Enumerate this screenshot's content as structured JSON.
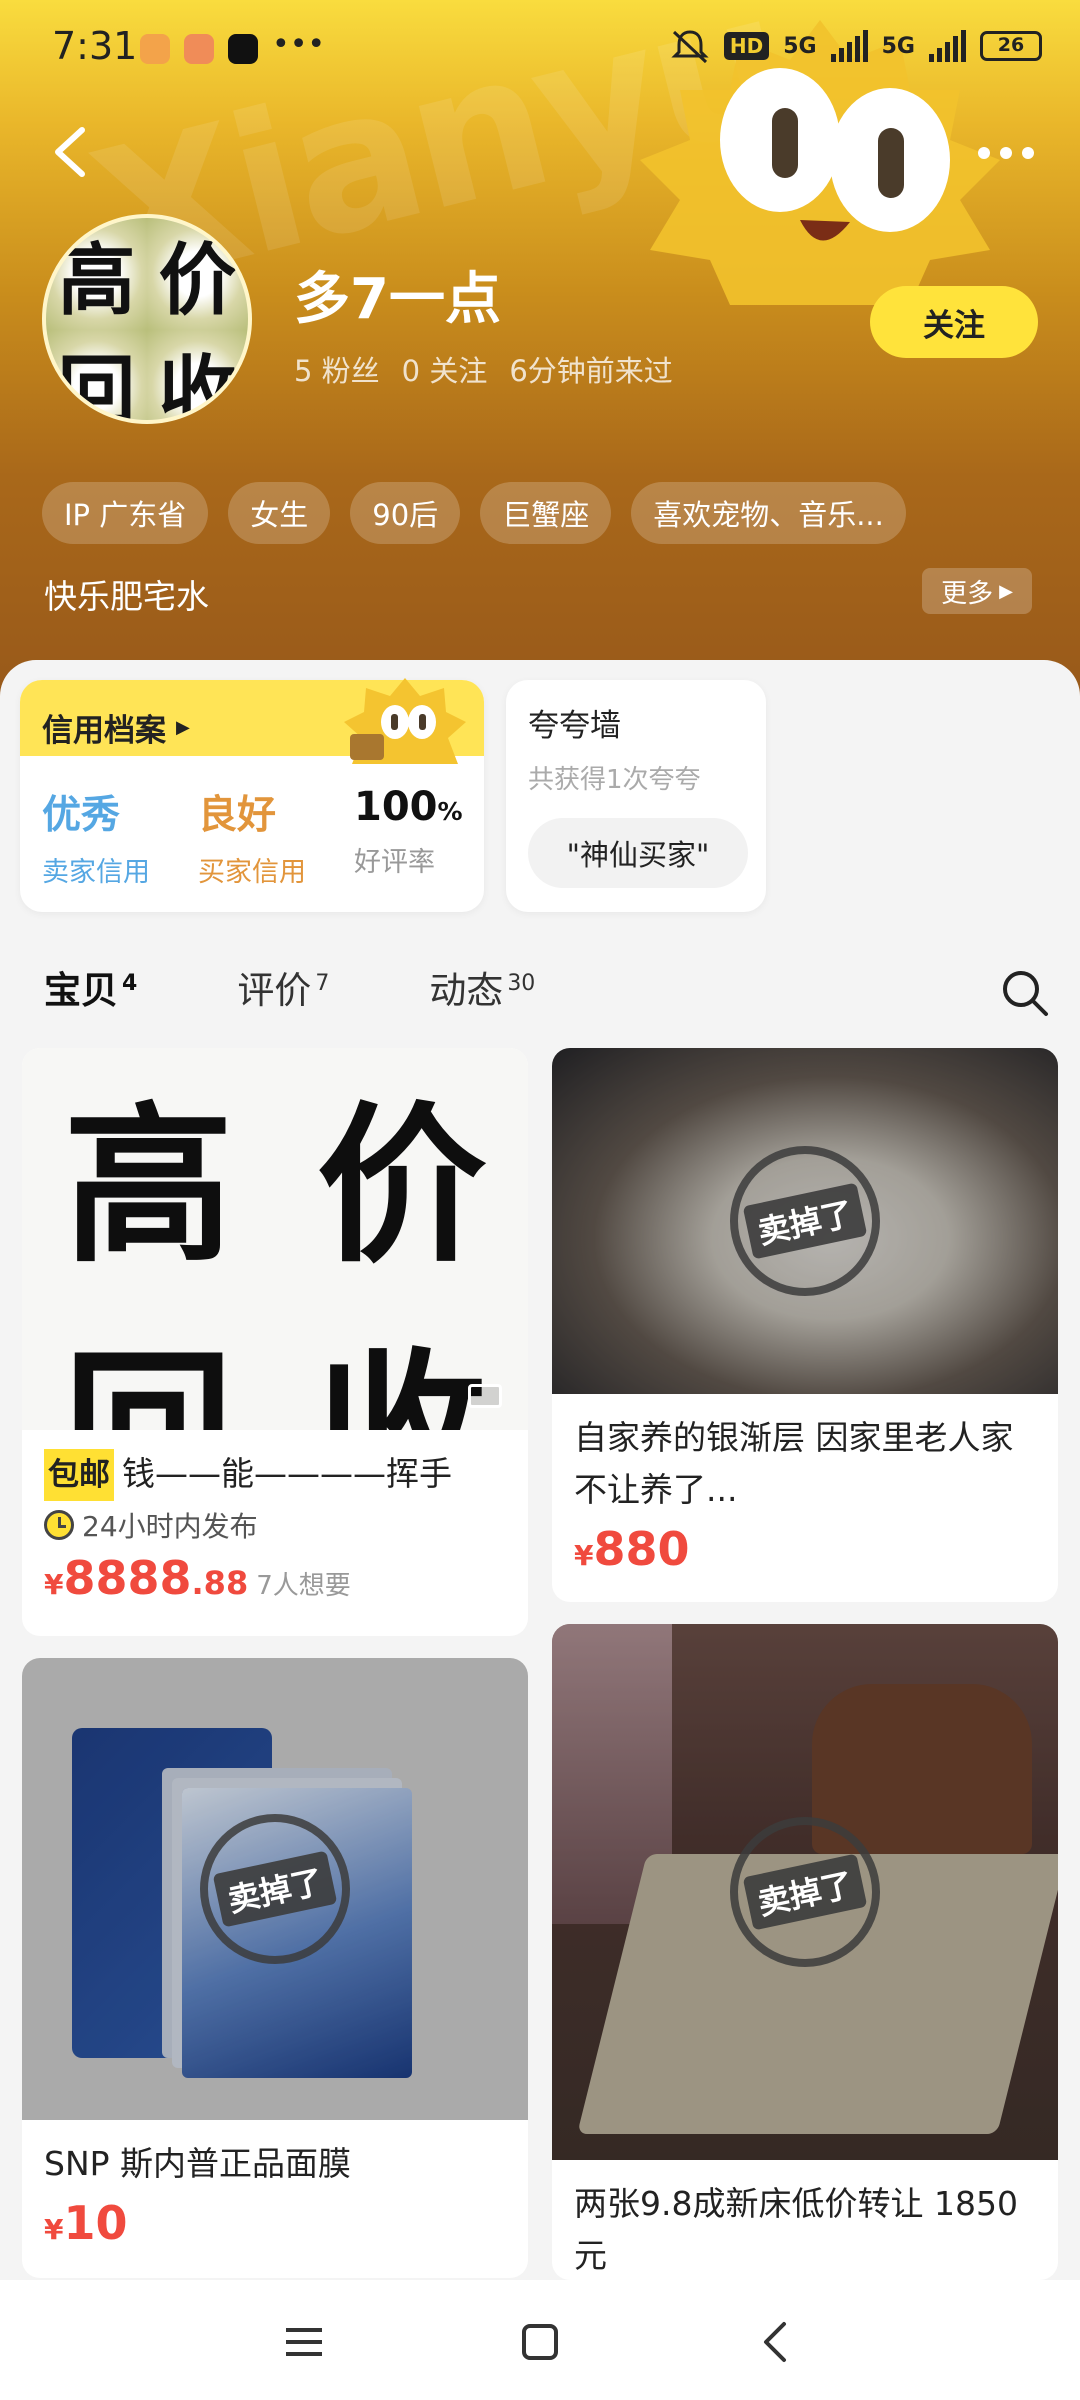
{
  "status_bar": {
    "time": "7:31",
    "hd": "HD",
    "net1": "5G",
    "net2": "5G",
    "battery": "26"
  },
  "header": {
    "nickname": "多7一点",
    "avatar_chars": [
      "高",
      "价",
      "回",
      "收"
    ],
    "fans": "5 粉丝",
    "following": "0 关注",
    "last_seen": "6分钟前来过",
    "follow_label": "关注",
    "tags": [
      "IP 广东省",
      "女生",
      "90后",
      "巨蟹座",
      "喜欢宠物、音乐..."
    ],
    "bio": "快乐肥宅水",
    "more_label": "更多"
  },
  "credit": {
    "title": "信用档案",
    "seller_level": "优秀",
    "seller_label": "卖家信用",
    "buyer_level": "良好",
    "buyer_label": "买家信用",
    "rate_value": "100",
    "rate_unit": "%",
    "rate_label": "好评率"
  },
  "praise": {
    "title": "夸夸墙",
    "subtitle": "共获得1次夸夸",
    "chip": "\"神仙买家\""
  },
  "tabs": [
    {
      "label": "宝贝",
      "count": "4"
    },
    {
      "label": "评价",
      "count": "7"
    },
    {
      "label": "动态",
      "count": "30"
    }
  ],
  "products": [
    {
      "image_chars": [
        "高",
        "价",
        "回",
        "收"
      ],
      "badge": "包邮",
      "title": "钱——能————挥手",
      "published": "24小时内发布",
      "currency": "¥",
      "price_int": "8888",
      "price_dec": ".88",
      "wants": "7人想要"
    },
    {
      "title": "自家养的银渐层 因家里老人家不让养了...",
      "currency": "¥",
      "price_int": "880",
      "stamp": "卖掉了"
    },
    {
      "title": "SNP 斯内普正品面膜",
      "currency": "¥",
      "price_int": "10",
      "stamp": "卖掉了"
    },
    {
      "title": "两张9.8成新床低价转让 1850元",
      "stamp": "卖掉了"
    }
  ]
}
